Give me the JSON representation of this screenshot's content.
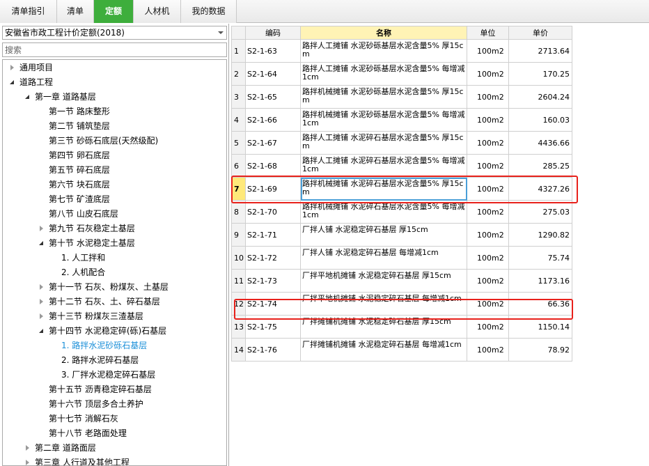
{
  "tabs": [
    {
      "label": "清单指引",
      "active": false
    },
    {
      "label": "清单",
      "active": false
    },
    {
      "label": "定额",
      "active": true
    },
    {
      "label": "人材机",
      "active": false
    },
    {
      "label": "我的数据",
      "active": false
    }
  ],
  "library": {
    "selected": "安徽省市政工程计价定额(2018)"
  },
  "search": {
    "placeholder": "搜索",
    "value": ""
  },
  "tree": [
    {
      "label": "通用项目",
      "level": 0,
      "state": "closed",
      "selected": false
    },
    {
      "label": "道路工程",
      "level": 0,
      "state": "open",
      "selected": false
    },
    {
      "label": "第一章 道路基层",
      "level": 1,
      "state": "open",
      "selected": false
    },
    {
      "label": "第一节 路床整形",
      "level": 2,
      "state": "leaf",
      "selected": false
    },
    {
      "label": "第二节 铺筑垫层",
      "level": 2,
      "state": "leaf",
      "selected": false
    },
    {
      "label": "第三节 砂砾石底层(天然级配)",
      "level": 2,
      "state": "leaf",
      "selected": false
    },
    {
      "label": "第四节 卵石底层",
      "level": 2,
      "state": "leaf",
      "selected": false
    },
    {
      "label": "第五节 碎石底层",
      "level": 2,
      "state": "leaf",
      "selected": false
    },
    {
      "label": "第六节 块石底层",
      "level": 2,
      "state": "leaf",
      "selected": false
    },
    {
      "label": "第七节 矿渣底层",
      "level": 2,
      "state": "leaf",
      "selected": false
    },
    {
      "label": "第八节 山皮石底层",
      "level": 2,
      "state": "leaf",
      "selected": false
    },
    {
      "label": "第九节 石灰稳定土基层",
      "level": 2,
      "state": "closed",
      "selected": false
    },
    {
      "label": "第十节 水泥稳定土基层",
      "level": 2,
      "state": "open",
      "selected": false
    },
    {
      "label": "1. 人工拌和",
      "level": 3,
      "state": "leaf",
      "selected": false
    },
    {
      "label": "2. 人机配合",
      "level": 3,
      "state": "leaf",
      "selected": false
    },
    {
      "label": "第十一节 石灰、粉煤灰、土基层",
      "level": 2,
      "state": "closed",
      "selected": false
    },
    {
      "label": "第十二节 石灰、土、碎石基层",
      "level": 2,
      "state": "closed",
      "selected": false
    },
    {
      "label": "第十三节 粉煤灰三渣基层",
      "level": 2,
      "state": "closed",
      "selected": false
    },
    {
      "label": "第十四节 水泥稳定碎(砾)石基层",
      "level": 2,
      "state": "open",
      "selected": false
    },
    {
      "label": "1. 路拌水泥砂砾石基层",
      "level": 3,
      "state": "leaf",
      "selected": true
    },
    {
      "label": "2. 路拌水泥碎石基层",
      "level": 3,
      "state": "leaf",
      "selected": false
    },
    {
      "label": "3. 厂拌水泥稳定碎石基层",
      "level": 3,
      "state": "leaf",
      "selected": false
    },
    {
      "label": "第十五节 沥青稳定碎石基层",
      "level": 2,
      "state": "leaf",
      "selected": false
    },
    {
      "label": "第十六节 顶层多合土养护",
      "level": 2,
      "state": "leaf",
      "selected": false
    },
    {
      "label": "第十七节 消解石灰",
      "level": 2,
      "state": "leaf",
      "selected": false
    },
    {
      "label": "第十八节 老路面处理",
      "level": 2,
      "state": "leaf",
      "selected": false
    },
    {
      "label": "第二章 道路面层",
      "level": 1,
      "state": "closed",
      "selected": false
    },
    {
      "label": "第三章 人行道及其他工程",
      "level": 1,
      "state": "closed",
      "selected": false
    }
  ],
  "grid": {
    "headers": {
      "rownum": "",
      "code": "编码",
      "name": "名称",
      "unit": "单位",
      "price": "单价"
    },
    "rows": [
      {
        "num": "1",
        "code": "S2-1-63",
        "name": "路拌人工摊铺 水泥砂砾基层水泥含量5% 厚15cm",
        "unit": "100m2",
        "price": "2713.64"
      },
      {
        "num": "2",
        "code": "S2-1-64",
        "name": "路拌人工摊铺 水泥砂砾基层水泥含量5% 每增减1cm",
        "unit": "100m2",
        "price": "170.25"
      },
      {
        "num": "3",
        "code": "S2-1-65",
        "name": "路拌机械摊铺 水泥砂砾基层水泥含量5% 厚15cm",
        "unit": "100m2",
        "price": "2604.24"
      },
      {
        "num": "4",
        "code": "S2-1-66",
        "name": "路拌机械摊铺 水泥砂砾基层水泥含量5% 每增减1cm",
        "unit": "100m2",
        "price": "160.03"
      },
      {
        "num": "5",
        "code": "S2-1-67",
        "name": "路拌人工摊铺 水泥碎石基层水泥含量5% 厚15cm",
        "unit": "100m2",
        "price": "4436.66"
      },
      {
        "num": "6",
        "code": "S2-1-68",
        "name": "路拌人工摊铺 水泥碎石基层水泥含量5% 每增减1cm",
        "unit": "100m2",
        "price": "285.25"
      },
      {
        "num": "7",
        "code": "S2-1-69",
        "name": "路拌机械摊铺 水泥碎石基层水泥含量5% 厚15cm",
        "unit": "100m2",
        "price": "4327.26",
        "current": true
      },
      {
        "num": "8",
        "code": "S2-1-70",
        "name": "路拌机械摊铺 水泥碎石基层水泥含量5% 每增减1cm",
        "unit": "100m2",
        "price": "275.03"
      },
      {
        "num": "9",
        "code": "S2-1-71",
        "name": "厂拌人铺 水泥稳定碎石基层 厚15cm",
        "unit": "100m2",
        "price": "1290.82"
      },
      {
        "num": "10",
        "code": "S2-1-72",
        "name": "厂拌人铺 水泥稳定碎石基层 每增减1cm",
        "unit": "100m2",
        "price": "75.74"
      },
      {
        "num": "11",
        "code": "S2-1-73",
        "name": "厂拌平地机摊铺 水泥稳定碎石基层 厚15cm",
        "unit": "100m2",
        "price": "1173.16"
      },
      {
        "num": "12",
        "code": "S2-1-74",
        "name": "厂拌平地机摊铺 水泥稳定碎石基层 每增减1cm",
        "unit": "100m2",
        "price": "66.36"
      },
      {
        "num": "13",
        "code": "S2-1-75",
        "name": "厂拌摊铺机摊铺 水泥稳定碎石基层 厚15cm",
        "unit": "100m2",
        "price": "1150.14"
      },
      {
        "num": "14",
        "code": "S2-1-76",
        "name": "厂拌摊铺机摊铺 水泥稳定碎石基层 每增减1cm",
        "unit": "100m2",
        "price": "78.92"
      }
    ]
  },
  "colors": {
    "active_tab": "#3eae3c",
    "highlight": "#e8211b",
    "selected_tree": "#1a8fd8"
  }
}
